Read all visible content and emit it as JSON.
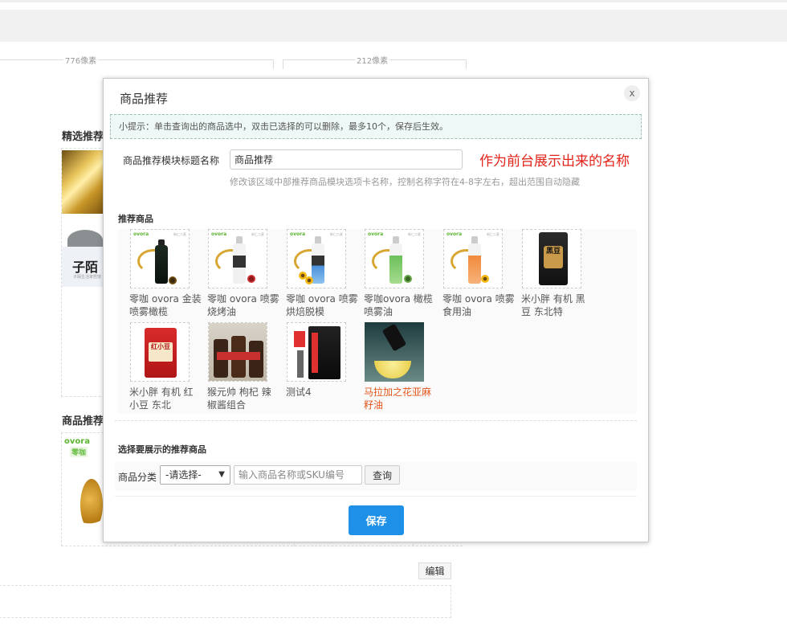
{
  "background": {
    "ruler_left_label": "776像素",
    "ruler_right_label": "212像素",
    "section_featured": "精选推荐",
    "section_products": "商品推荐",
    "logo_text": "子陌",
    "logo_small_text": "子陌生活家居馆",
    "ovora_mini_text": "ovora",
    "ovora_mini_sub": "零咖",
    "edit_button": "编辑"
  },
  "modal": {
    "title": "商品推荐",
    "close_label": "x",
    "tip": "小提示：单击查询出的商品选中，双击已选择的可以删除，最多10个，保存后生效。",
    "title_field_label": "商品推荐模块标题名称",
    "title_field_value": "商品推荐",
    "annotation": "作为前台展示出来的名称",
    "hint": "修改该区域中部推荐商品模块选项卡名称，控制名称字符在4-8字左右，超出范围自动隐藏",
    "recommended_heading": "推荐商品",
    "thumb_brand": "ovora",
    "thumb_tag": "新仁二麦",
    "bag_text_1": "黑豆",
    "bag_text_2": "红小豆",
    "products": [
      {
        "name": "零咖 ovora 金装喷雾橄榄"
      },
      {
        "name": "零咖 ovora 喷雾烧烤油"
      },
      {
        "name": "零咖 ovora 喷雾烘焙脱模"
      },
      {
        "name": "零咖ovora 橄榄喷雾油"
      },
      {
        "name": "零咖 ovora 喷雾食用油"
      },
      {
        "name": "米小胖 有机 黑豆 东北特"
      },
      {
        "name": "米小胖 有机 红小豆 东北"
      },
      {
        "name": "猴元帅 枸杞 辣椒酱组合"
      },
      {
        "name": "测试4"
      },
      {
        "name": "马拉加之花亚麻籽油"
      }
    ],
    "select_heading": "选择要展示的推荐商品",
    "category_label": "商品分类",
    "category_select_value": "-请选择-",
    "category_caret": "▼",
    "search_placeholder": "输入商品名称或SKU编号",
    "query_button": "查询",
    "save_button": "保存"
  },
  "colors": {
    "accent_blue": "#1e90e8",
    "annotation_red": "#e2231a",
    "highlight_product": "#e2551a",
    "tip_background": "#eef8f6",
    "tip_border": "#9ec2b3",
    "brand_green": "#5cb531"
  }
}
